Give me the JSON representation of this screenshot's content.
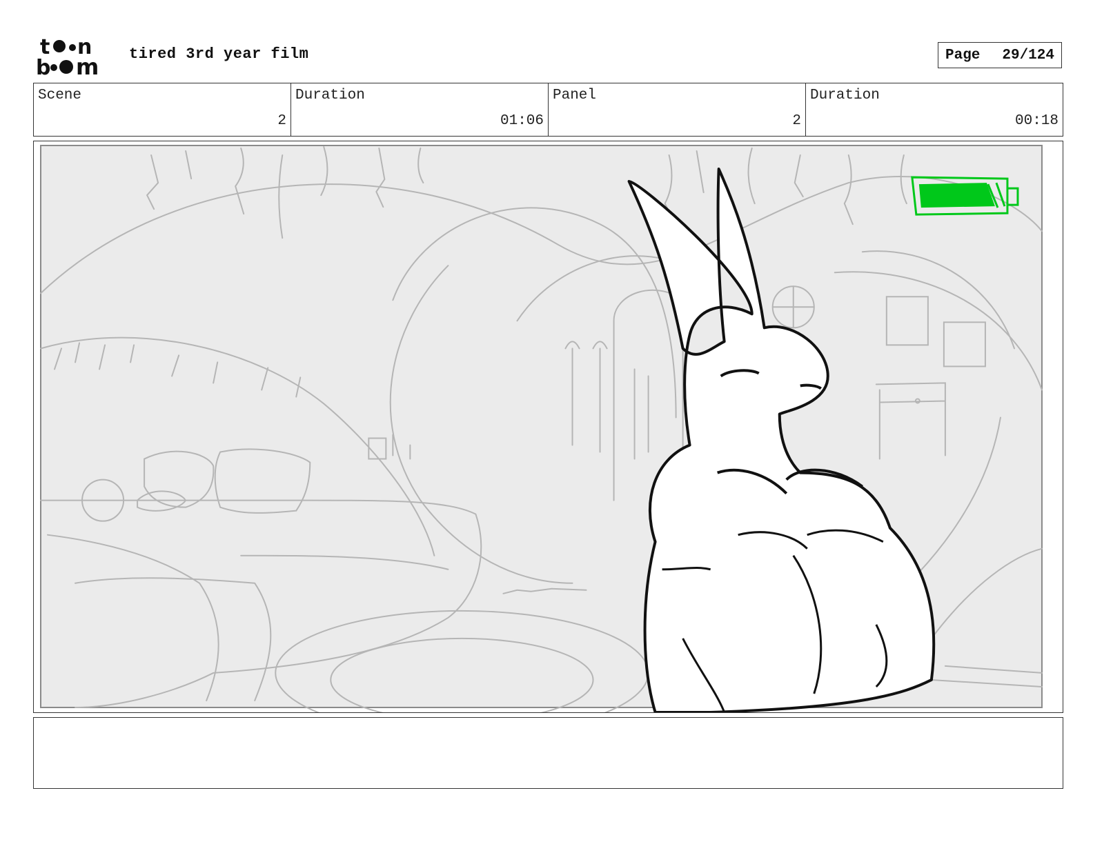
{
  "header": {
    "logo_text": "toon boom",
    "project_title": "tired 3rd year film",
    "page_label": "Page",
    "page_number": "29/124"
  },
  "info": {
    "scene_label": "Scene",
    "scene_value": "2",
    "scene_duration_label": "Duration",
    "scene_duration_value": "01:06",
    "panel_label": "Panel",
    "panel_value": "2",
    "panel_duration_label": "Duration",
    "panel_duration_value": "00:18"
  },
  "panel": {
    "battery_color": "#00c81a",
    "sketch_color": "#b5b5b5",
    "background_color": "#ebebeb",
    "ink_color": "#111111",
    "icons": [
      "battery-icon",
      "rabbit-figure"
    ]
  },
  "notes": {
    "text": ""
  }
}
